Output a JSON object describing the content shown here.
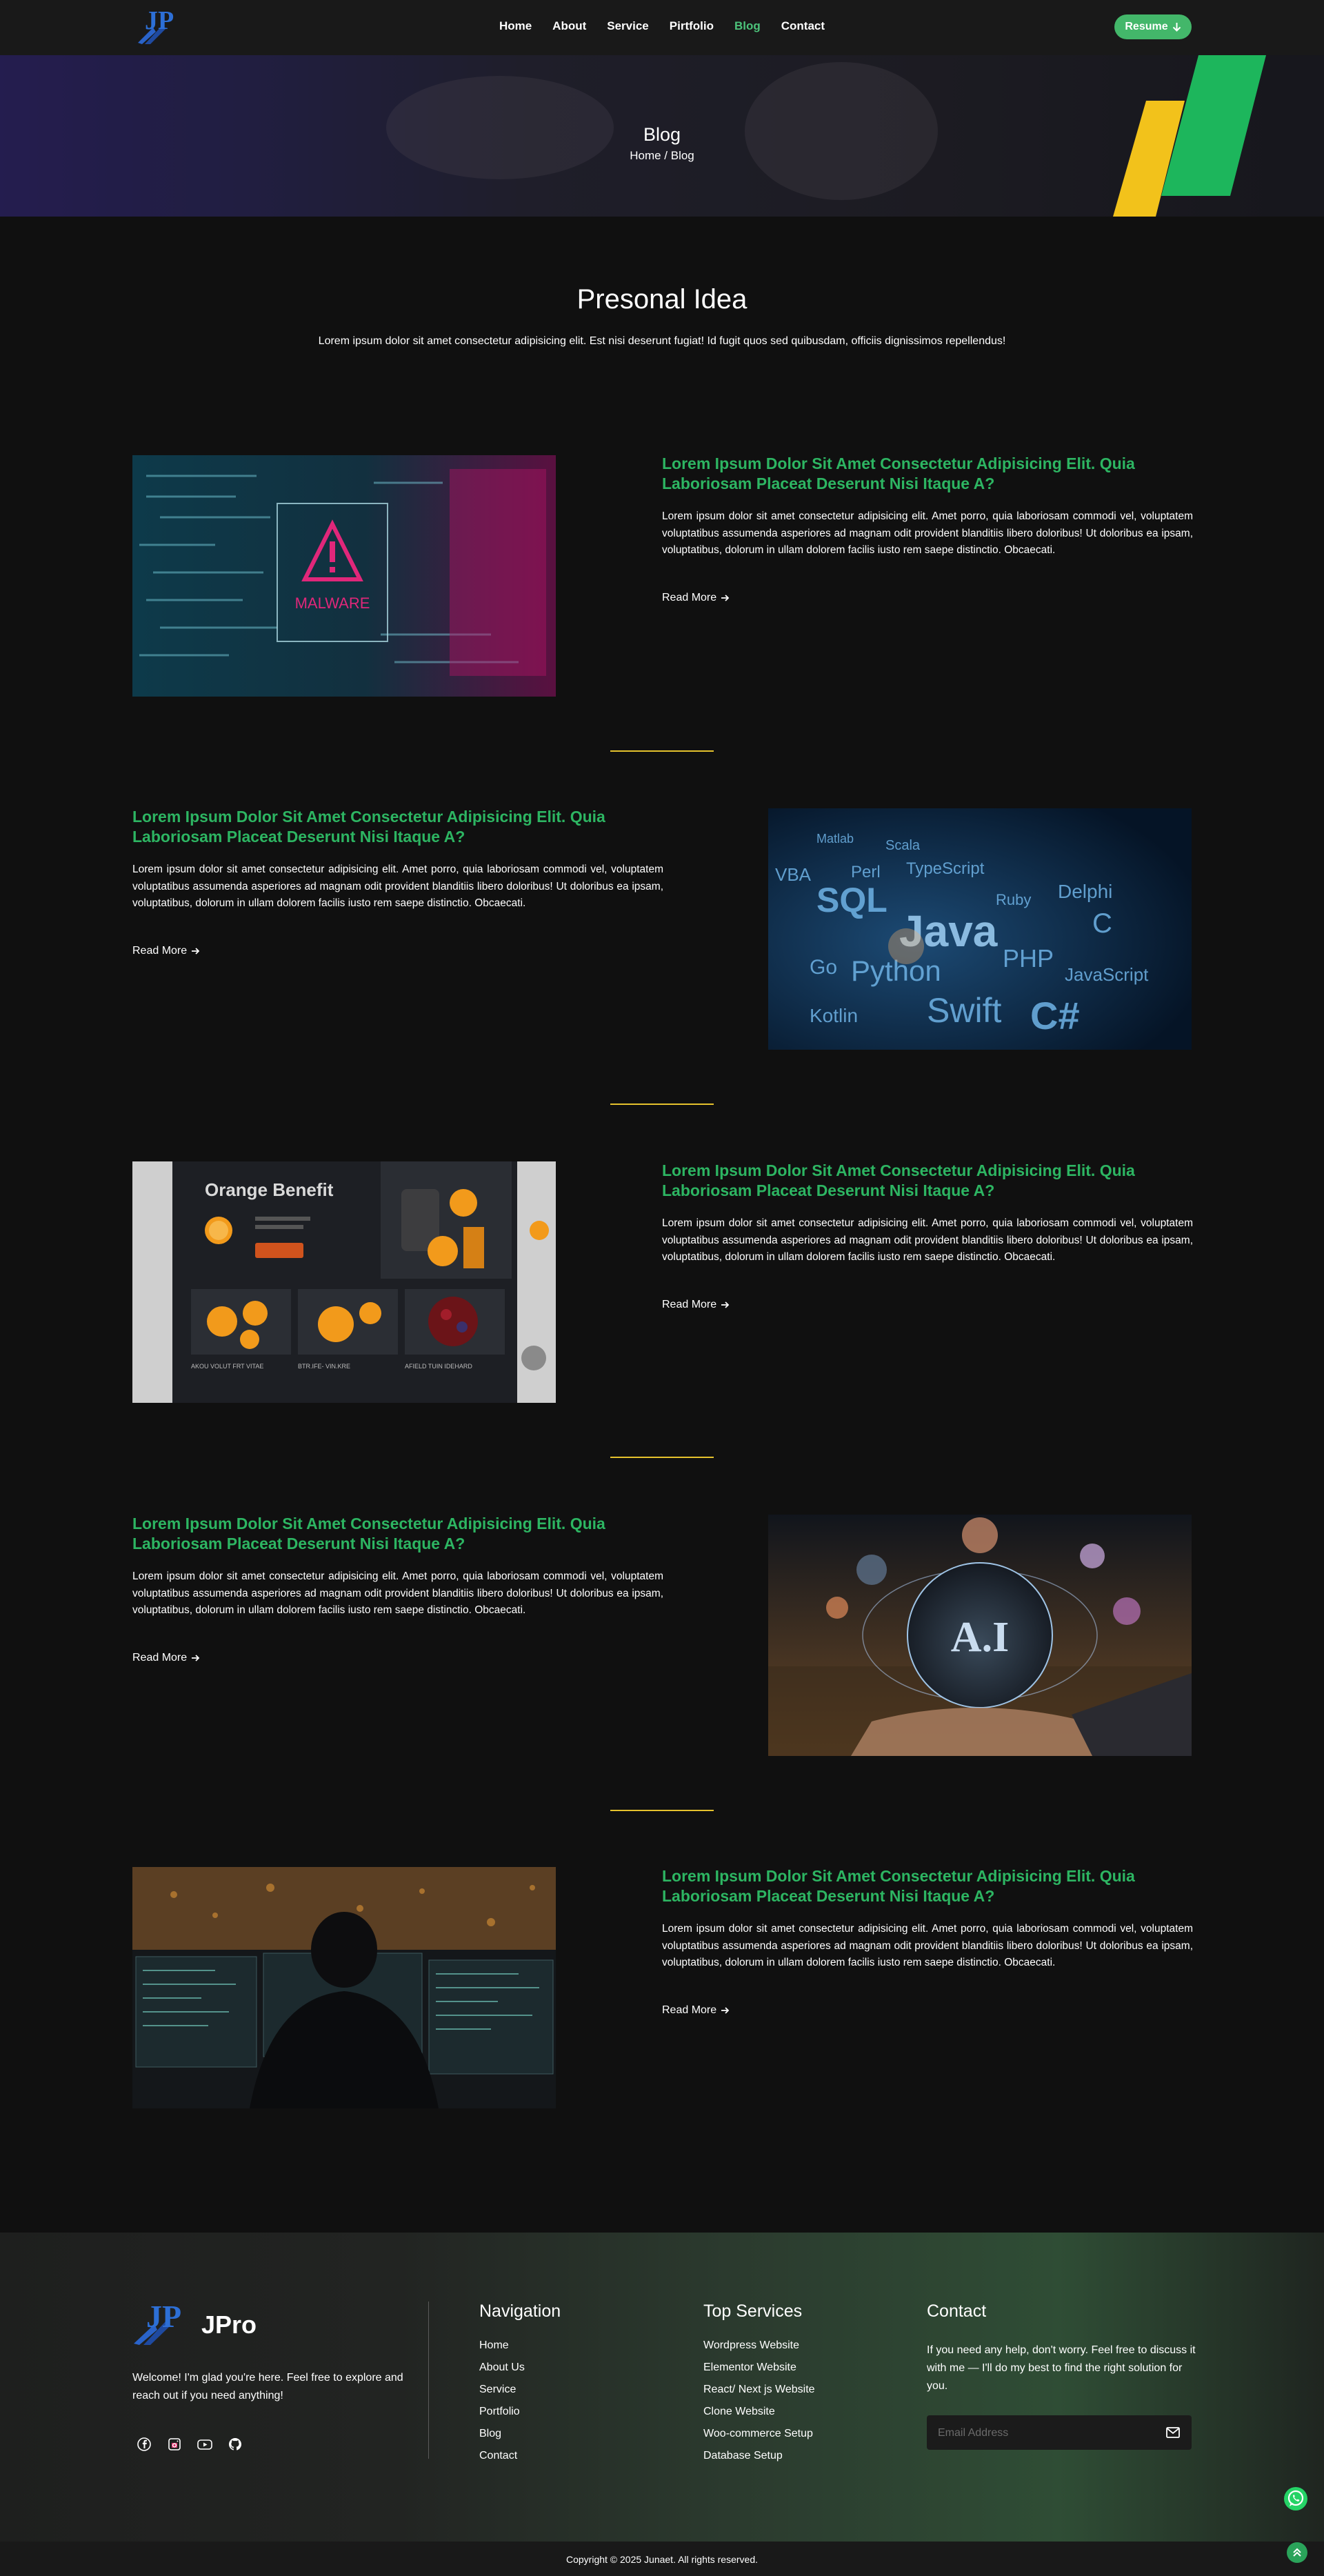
{
  "nav": {
    "items": [
      "Home",
      "About",
      "Service",
      "Pirtfolio",
      "Blog",
      "Contact"
    ],
    "active_index": 4,
    "resume_label": "Resume"
  },
  "banner": {
    "title": "Blog",
    "breadcrumb": "Home / Blog"
  },
  "section": {
    "title": "Presonal Idea",
    "subtitle": "Lorem ipsum dolor sit amet consectetur adipisicing elit. Est nisi deserunt fugiat! Id fugit quos sed quibusdam, officiis dignissimos repellendus!"
  },
  "posts": [
    {
      "title": "Lorem Ipsum Dolor Sit Amet Consectetur Adipisicing Elit. Quia Laboriosam Placeat Deserunt Nisi Itaque A?",
      "text": "Lorem ipsum dolor sit amet consectetur adipisicing elit. Amet porro, quia laboriosam commodi vel, voluptatem voluptatibus assumenda asperiores ad magnam odit provident blanditiis libero doloribus! Ut doloribus ea ipsam, voluptatibus, dolorum in ullam dolorem facilis iusto rem saepe distinctio. Obcaecati.",
      "read_more": "Read More",
      "image_label": "MALWARE"
    },
    {
      "title": "Lorem Ipsum Dolor Sit Amet Consectetur Adipisicing Elit. Quia Laboriosam Placeat Deserunt Nisi Itaque A?",
      "text": "Lorem ipsum dolor sit amet consectetur adipisicing elit. Amet porro, quia laboriosam commodi vel, voluptatem voluptatibus assumenda asperiores ad magnam odit provident blanditiis libero doloribus! Ut doloribus ea ipsam, voluptatibus, dolorum in ullam dolorem facilis iusto rem saepe distinctio. Obcaecati.",
      "read_more": "Read More",
      "image_words": [
        "Matlab",
        "Scala",
        "VBA",
        "Perl",
        "TypeScript",
        "SQL",
        "Ruby",
        "Delphi",
        "Java",
        "C",
        "Go",
        "Python",
        "PHP",
        "JavaScript",
        "Kotlin",
        "Swift",
        "C#"
      ]
    },
    {
      "title": "Lorem Ipsum Dolor Sit Amet Consectetur Adipisicing Elit. Quia Laboriosam Placeat Deserunt Nisi Itaque A?",
      "text": "Lorem ipsum dolor sit amet consectetur adipisicing elit. Amet porro, quia laboriosam commodi vel, voluptatem voluptatibus assumenda asperiores ad magnam odit provident blanditiis libero doloribus! Ut doloribus ea ipsam, voluptatibus, dolorum in ullam dolorem facilis iusto rem saepe distinctio. Obcaecati.",
      "read_more": "Read More",
      "image_heading": "Orange Benefit",
      "image_cards": [
        "AKOU VOLUT FRT VITAE",
        "BTR.IFE- VIN.KRE",
        "AFIELD TUIN IDEHARD"
      ]
    },
    {
      "title": "Lorem Ipsum Dolor Sit Amet Consectetur Adipisicing Elit. Quia Laboriosam Placeat Deserunt Nisi Itaque A?",
      "text": "Lorem ipsum dolor sit amet consectetur adipisicing elit. Amet porro, quia laboriosam commodi vel, voluptatem voluptatibus assumenda asperiores ad magnam odit provident blanditiis libero doloribus! Ut doloribus ea ipsam, voluptatibus, dolorum in ullam dolorem facilis iusto rem saepe distinctio. Obcaecati.",
      "read_more": "Read More",
      "image_label": "A.I"
    },
    {
      "title": "Lorem Ipsum Dolor Sit Amet Consectetur Adipisicing Elit. Quia Laboriosam Placeat Deserunt Nisi Itaque A?",
      "text": "Lorem ipsum dolor sit amet consectetur adipisicing elit. Amet porro, quia laboriosam commodi vel, voluptatem voluptatibus assumenda asperiores ad magnam odit provident blanditiis libero doloribus! Ut doloribus ea ipsam, voluptatibus, dolorum in ullam dolorem facilis iusto rem saepe distinctio. Obcaecati.",
      "read_more": "Read More"
    }
  ],
  "footer": {
    "brand": "JPro",
    "welcome": "Welcome! I'm glad you're here. Feel free to explore and reach out if you need anything!",
    "social_icons": [
      "facebook-icon",
      "instagram-icon",
      "youtube-icon",
      "github-icon"
    ],
    "navigation": {
      "title": "Navigation",
      "items": [
        "Home",
        "About Us",
        "Service",
        "Portfolio",
        "Blog",
        "Contact"
      ]
    },
    "services": {
      "title": "Top Services",
      "items": [
        "Wordpress Website",
        "Elementor Website",
        "React/ Next js Website",
        "Clone Website",
        "Woo-commerce Setup",
        "Database Setup"
      ]
    },
    "contact": {
      "title": "Contact",
      "text": "If you need any help, don't worry. Feel free to discuss it with me — I'll do my best to find the right solution for you.",
      "email_placeholder": "Email Address"
    },
    "copyright": "Copyright © 2025 Junaet. All rights reserved."
  },
  "colors": {
    "accent_green": "#2db562",
    "button_green": "#43b76a",
    "divider_yellow": "#e5c22d",
    "background": "#101010"
  }
}
